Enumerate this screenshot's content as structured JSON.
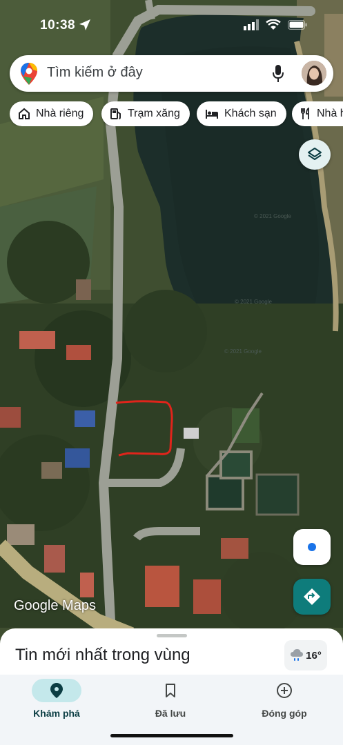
{
  "status_bar": {
    "time": "10:38",
    "icons": [
      "location-arrow-icon",
      "signal-icon",
      "wifi-icon",
      "battery-icon"
    ]
  },
  "search": {
    "placeholder": "Tìm kiếm ở đây"
  },
  "chips": [
    {
      "label": "Nhà riêng",
      "icon": "home-icon"
    },
    {
      "label": "Trạm xăng",
      "icon": "gas-station-icon"
    },
    {
      "label": "Khách sạn",
      "icon": "hotel-bed-icon"
    },
    {
      "label": "Nhà hàng",
      "icon": "restaurant-icon"
    }
  ],
  "map": {
    "attribution": "Google Maps",
    "watermark": "© 2021 Google",
    "marked_area_color": "#e0241b"
  },
  "sheet": {
    "title": "Tin mới nhất trong vùng",
    "weather_temp": "16°"
  },
  "nav": {
    "items": [
      {
        "label": "Khám phá",
        "icon": "explore-pin-icon",
        "active": true
      },
      {
        "label": "Đã lưu",
        "icon": "bookmark-icon",
        "active": false
      },
      {
        "label": "Đóng góp",
        "icon": "add-circle-icon",
        "active": false
      }
    ]
  },
  "colors": {
    "accent": "#0e7c7b",
    "active_nav_bg": "#c4e8eb",
    "location_blue": "#1a73e8"
  }
}
